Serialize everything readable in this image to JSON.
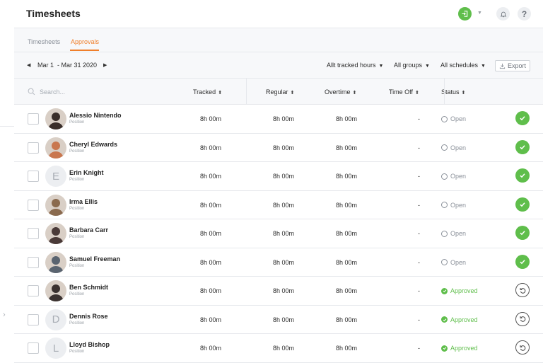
{
  "app": {
    "title": "Timesheets"
  },
  "tabs": [
    {
      "label": "Timesheets",
      "active": false
    },
    {
      "label": "Approvals",
      "active": true
    }
  ],
  "toolbar": {
    "date_range": "Mar 1  - Mar 31 2020",
    "filters": [
      "Allt tracked hours",
      "All groups",
      "All schedules"
    ],
    "export_label": "Export"
  },
  "table": {
    "search_placeholder": "Search...",
    "columns": {
      "tracked": "Tracked",
      "regular": "Regular",
      "overtime": "Overtime",
      "time_off": "Time Off",
      "status": "Status"
    },
    "rows": [
      {
        "name": "Alessio Nintendo",
        "position": "Position",
        "tracked": "8h 00m",
        "regular": "8h 00m",
        "overtime": "8h 00m",
        "time_off": "-",
        "status": "Open",
        "avatar": "photo",
        "initial": "",
        "tone": "#3a2e2a"
      },
      {
        "name": "Cheryl Edwards",
        "position": "Position",
        "tracked": "8h 00m",
        "regular": "8h 00m",
        "overtime": "8h 00m",
        "time_off": "-",
        "status": "Open",
        "avatar": "photo",
        "initial": "",
        "tone": "#c9774f"
      },
      {
        "name": "Erin Knight",
        "position": "Position",
        "tracked": "8h 00m",
        "regular": "8h 00m",
        "overtime": "8h 00m",
        "time_off": "-",
        "status": "Open",
        "avatar": "initial",
        "initial": "E",
        "tone": ""
      },
      {
        "name": "Irma Ellis",
        "position": "Position",
        "tracked": "8h 00m",
        "regular": "8h 00m",
        "overtime": "8h 00m",
        "time_off": "-",
        "status": "Open",
        "avatar": "photo",
        "initial": "",
        "tone": "#8a6a4e"
      },
      {
        "name": "Barbara Carr",
        "position": "Position",
        "tracked": "8h 00m",
        "regular": "8h 00m",
        "overtime": "8h 00m",
        "time_off": "-",
        "status": "Open",
        "avatar": "photo",
        "initial": "",
        "tone": "#4a3a38"
      },
      {
        "name": "Samuel Freeman",
        "position": "Position",
        "tracked": "8h 00m",
        "regular": "8h 00m",
        "overtime": "8h 00m",
        "time_off": "-",
        "status": "Open",
        "avatar": "photo",
        "initial": "",
        "tone": "#5a6470"
      },
      {
        "name": "Ben Schmidt",
        "position": "Position",
        "tracked": "8h 00m",
        "regular": "8h 00m",
        "overtime": "8h 00m",
        "time_off": "-",
        "status": "Approved",
        "avatar": "photo",
        "initial": "",
        "tone": "#3b3230"
      },
      {
        "name": "Dennis Rose",
        "position": "Position",
        "tracked": "8h 00m",
        "regular": "8h 00m",
        "overtime": "8h 00m",
        "time_off": "-",
        "status": "Approved",
        "avatar": "initial",
        "initial": "D",
        "tone": ""
      },
      {
        "name": "Lloyd Bishop",
        "position": "Position",
        "tracked": "8h 00m",
        "regular": "8h 00m",
        "overtime": "8h 00m",
        "time_off": "-",
        "status": "Approved",
        "avatar": "initial",
        "initial": "L",
        "tone": ""
      }
    ]
  },
  "colors": {
    "accent": "#f07f2b",
    "success": "#5fbe4b"
  },
  "icons": [
    "clock-in-icon",
    "caret-down-icon",
    "bell-icon",
    "help-icon",
    "search-icon",
    "export-icon",
    "check-icon",
    "undo-icon",
    "chevron-right-icon"
  ]
}
